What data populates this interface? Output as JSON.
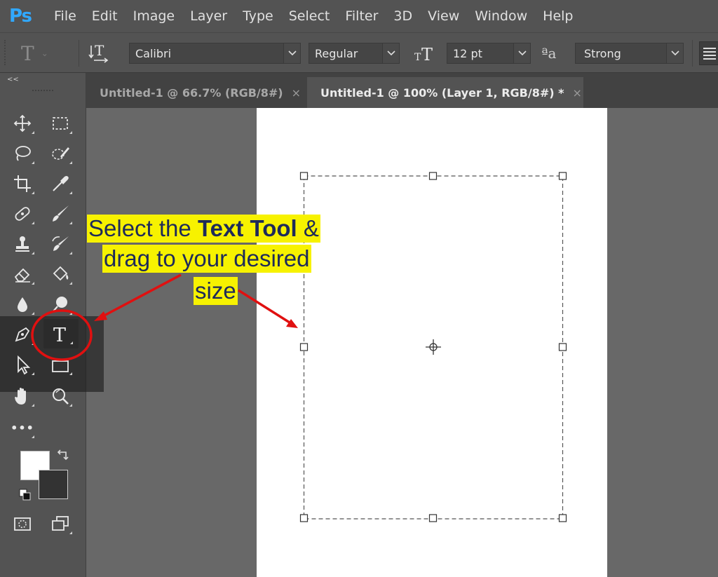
{
  "app": {
    "logo": "Ps"
  },
  "menu": [
    "File",
    "Edit",
    "Image",
    "Layer",
    "Type",
    "Select",
    "Filter",
    "3D",
    "View",
    "Window",
    "Help"
  ],
  "options_bar": {
    "tool_preset_glyph": "T",
    "font_family": "Calibri",
    "font_style": "Regular",
    "font_size": "12 pt",
    "aa_glyph": "ªa",
    "anti_alias": "Strong"
  },
  "toolbar": {
    "collapse_label": "<<",
    "tools": [
      "move-icon",
      "marquee-icon",
      "lasso-icon",
      "quick-select-icon",
      "crop-icon",
      "eyedropper-icon",
      "healing-icon",
      "brush-icon",
      "stamp-icon",
      "history-brush-icon",
      "eraser-icon",
      "paint-bucket-icon",
      "blur-icon",
      "dodge-icon",
      "pen-icon",
      "text-tool-icon",
      "path-select-icon",
      "rectangle-icon",
      "hand-icon",
      "zoom-icon",
      "more-tools-icon",
      "quick-mask-icon",
      "screen-mode-icon"
    ],
    "text_tool_glyph": "T",
    "more_tools_glyph": "•••",
    "foreground_color": "#ffffff",
    "background_color": "#333333"
  },
  "tabs": [
    {
      "label": "Untitled-1 @ 66.7% (RGB/8#)",
      "close": "×",
      "active": false
    },
    {
      "label": "Untitled-1 @ 100% (Layer 1, RGB/8#) *",
      "close": "×",
      "active": true
    }
  ],
  "annotation": {
    "line1_prefix": "Select the ",
    "line1_bold": "Text Tool",
    "line1_suffix": " &",
    "line2": "drag to your desired ",
    "line3": "size",
    "highlight_color": "#f7f200",
    "arrow_color": "#e01010"
  }
}
